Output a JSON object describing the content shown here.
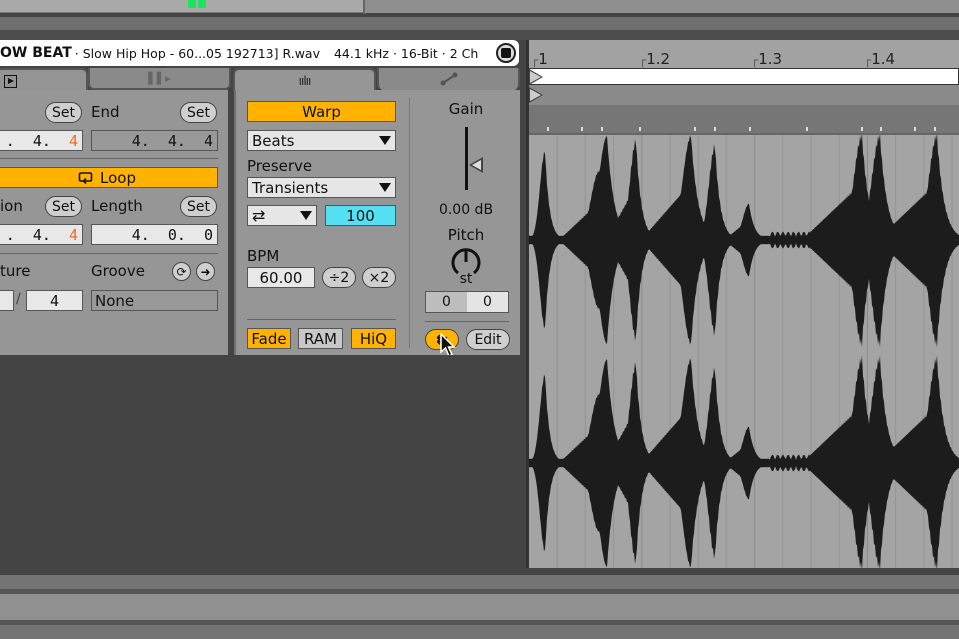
{
  "clip": {
    "name": "OW BEAT",
    "separator": "·",
    "file": "Slow Hip Hop - 60...05 192713] R.wav",
    "format": "44.1 kHz · 16-Bit · 2 Ch"
  },
  "tabs": [
    {
      "name": "clip",
      "icon": "play-icon"
    },
    {
      "name": "launch",
      "icon": "launch-icon"
    },
    {
      "name": "audio",
      "icon": "waveform-icon"
    },
    {
      "name": "envelopes",
      "icon": "envelope-icon"
    }
  ],
  "clip_panel": {
    "set_label": "Set",
    "end_label": "End",
    "start_value_prefix": ".  4.  ",
    "start_value_last": "4",
    "end_value": "4.  4.  4",
    "loop_label": "Loop",
    "position_label": "ion",
    "length_label": "Length",
    "position_value_prefix": ".  4.  ",
    "position_value_last": "4",
    "length_value": "4.  0.  0",
    "signature_label": "ture",
    "signature_denominator": "4",
    "signature_slash": "/",
    "groove_label": "Groove",
    "groove_value": "None"
  },
  "sample_panel": {
    "warp_label": "Warp",
    "warp_mode": "Beats",
    "preserve_label": "Preserve",
    "preserve_value": "Transients",
    "loop_mode_icon": "⇄",
    "envelope_value": "100",
    "bpm_label": "BPM",
    "bpm_value": "60.00",
    "half_label": "÷2",
    "double_label": "×2",
    "fade_label": "Fade",
    "ram_label": "RAM",
    "hiq_label": "HiQ",
    "gain_label": "Gain",
    "gain_value": "0.00 dB",
    "pitch_label": "Pitch",
    "pitch_unit": "st",
    "pitch_semitones": "0",
    "pitch_cents": "0",
    "reverse_icon": "⇇",
    "edit_label": "Edit"
  },
  "ruler": {
    "marks": [
      "1",
      "1.2",
      "1.3",
      "1.4"
    ]
  },
  "colors": {
    "accent_yellow": "#ffb300",
    "cyan": "#55dff2",
    "orange_value": "#f26b2a",
    "meter_green": "#19e35a"
  }
}
